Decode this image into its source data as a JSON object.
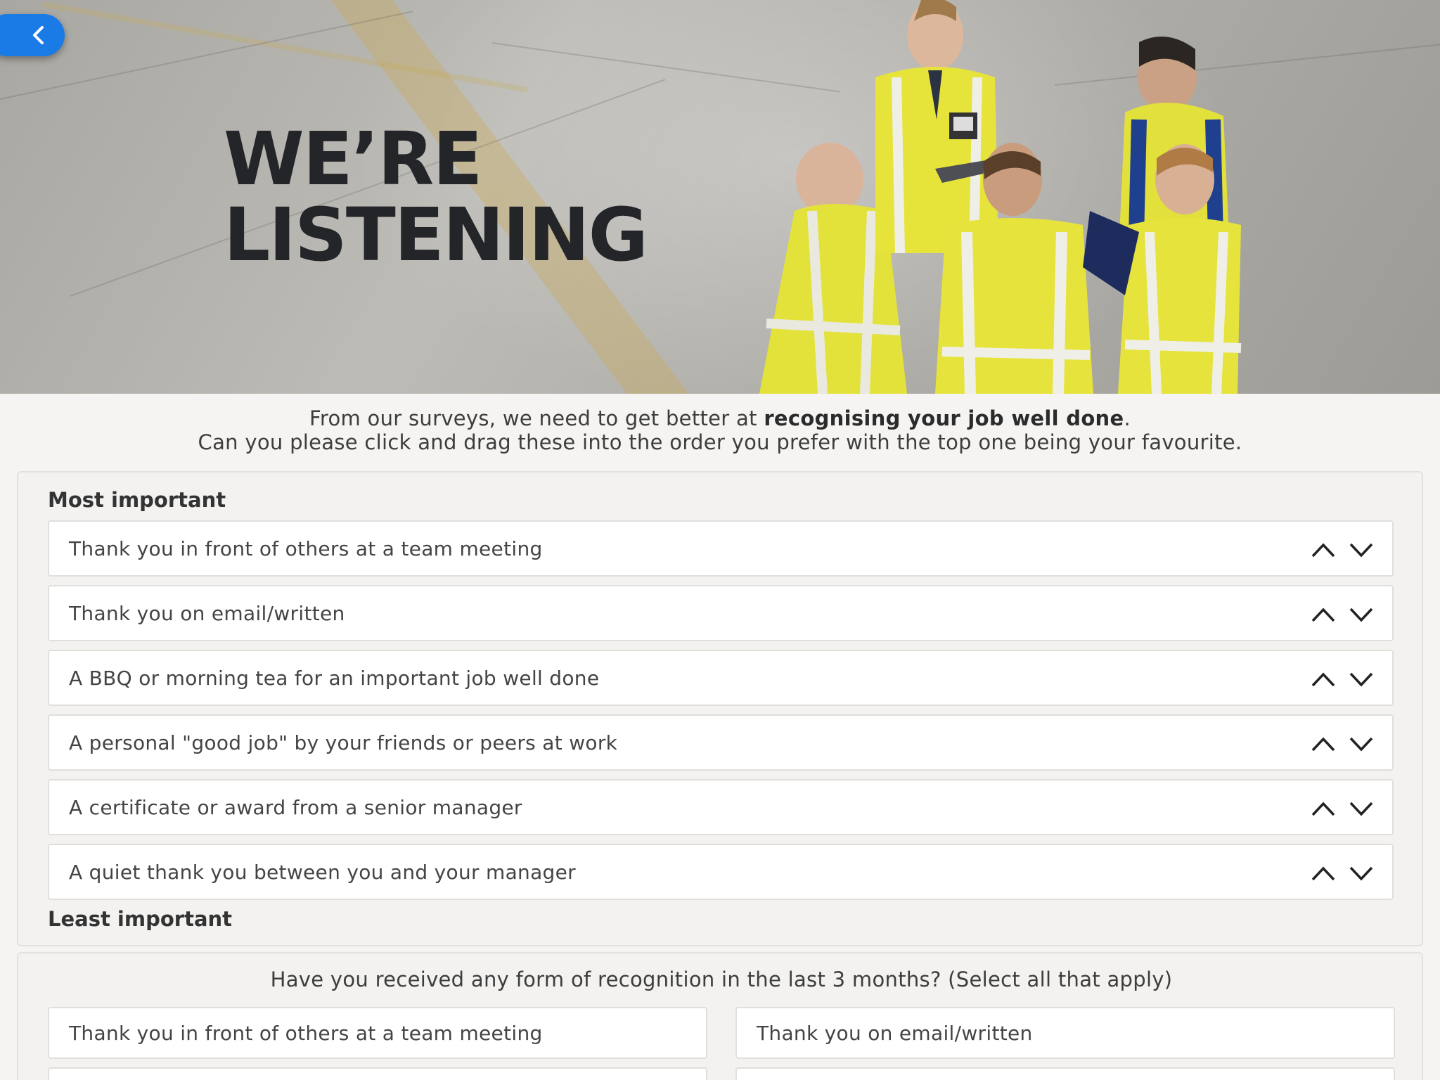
{
  "hero": {
    "title_line1": "WE’RE",
    "title_line2": "LISTENING",
    "back_icon": "chevron-left-icon",
    "accent_color": "#1a7be6"
  },
  "intro": {
    "line1_prefix": "From our surveys, we need to get better at ",
    "line1_bold": "recognising your job well done",
    "line1_suffix": ".",
    "line2": "Can you please click and drag these into the order you prefer with the top one being your favourite."
  },
  "ranking": {
    "top_label": "Most important",
    "bottom_label": "Least important",
    "up_icon": "chevron-up-icon",
    "down_icon": "chevron-down-icon",
    "items": [
      {
        "label": "Thank you in front of others at a team meeting"
      },
      {
        "label": "Thank you on email/written"
      },
      {
        "label": "A BBQ or morning tea for an important job well done"
      },
      {
        "label": "A personal \"good job\" by your friends or peers at work"
      },
      {
        "label": "A certificate or award from a senior manager"
      },
      {
        "label": "A quiet thank you between you and your manager"
      }
    ]
  },
  "recognition": {
    "question": "Have you received any form of recognition in the last 3 months? (Select all that apply)",
    "options": [
      {
        "label": "Thank you in front of others at a team meeting"
      },
      {
        "label": "Thank you on email/written"
      }
    ]
  }
}
